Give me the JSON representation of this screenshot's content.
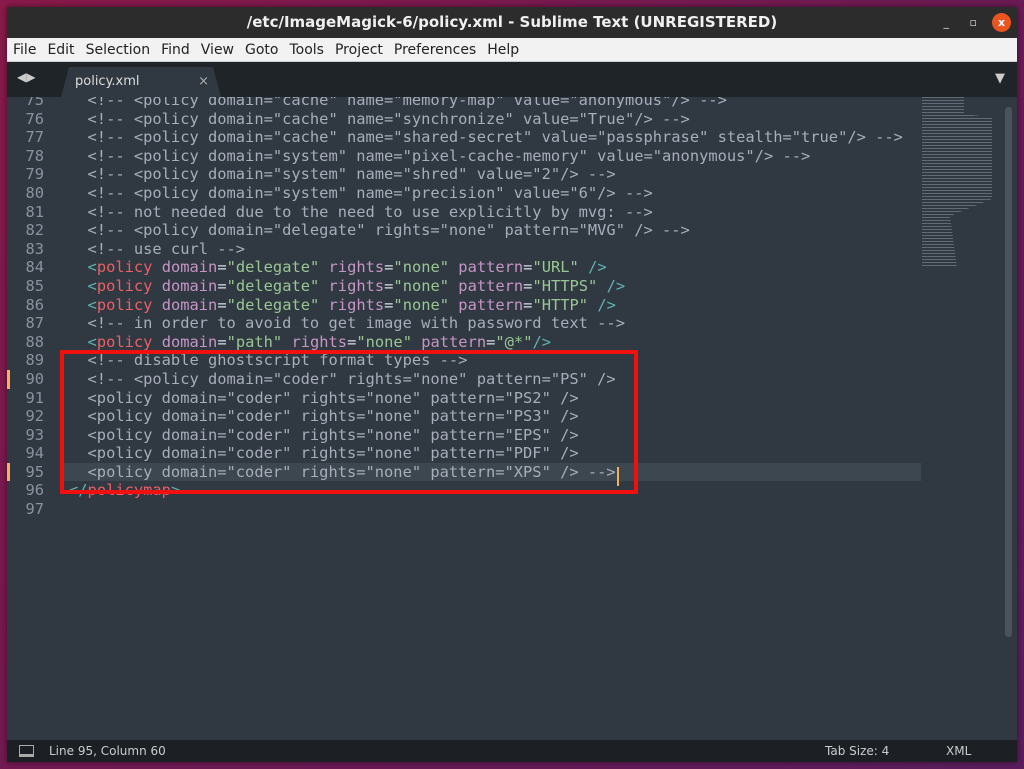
{
  "window": {
    "title": "/etc/ImageMagick-6/policy.xml - Sublime Text (UNREGISTERED)",
    "minimize": "_",
    "maximize": "▫",
    "close": "x"
  },
  "menu": [
    "File",
    "Edit",
    "Selection",
    "Find",
    "View",
    "Goto",
    "Tools",
    "Project",
    "Preferences",
    "Help"
  ],
  "tab": {
    "label": "policy.xml",
    "close": "×"
  },
  "status": {
    "position": "Line 95, Column 60",
    "tab_size": "Tab Size: 4",
    "syntax": "XML"
  },
  "colors": {
    "highlight_box": "#f01010",
    "modified_marker": "#f9ae58",
    "background": "#303841"
  },
  "current_line": 95,
  "modified_lines": [
    90,
    95
  ],
  "lines": [
    {
      "n": "75",
      "seg": [
        [
          "c",
          "  <!-- <policy domain=\"cache\" name=\"memory-map\" value=\"anonymous\"/> -->"
        ]
      ]
    },
    {
      "n": "76",
      "seg": [
        [
          "c",
          "  <!-- <policy domain=\"cache\" name=\"synchronize\" value=\"True\"/> -->"
        ]
      ]
    },
    {
      "n": "77",
      "seg": [
        [
          "c",
          "  <!-- <policy domain=\"cache\" name=\"shared-secret\" value=\"passphrase\" stealth=\"true\"/> -->"
        ]
      ]
    },
    {
      "n": "78",
      "seg": [
        [
          "c",
          "  <!-- <policy domain=\"system\" name=\"pixel-cache-memory\" value=\"anonymous\"/> -->"
        ]
      ]
    },
    {
      "n": "79",
      "seg": [
        [
          "c",
          "  <!-- <policy domain=\"system\" name=\"shred\" value=\"2\"/> -->"
        ]
      ]
    },
    {
      "n": "80",
      "seg": [
        [
          "c",
          "  <!-- <policy domain=\"system\" name=\"precision\" value=\"6\"/> -->"
        ]
      ]
    },
    {
      "n": "81",
      "seg": [
        [
          "c",
          "  <!-- not needed due to the need to use explicitly by mvg: -->"
        ]
      ]
    },
    {
      "n": "82",
      "seg": [
        [
          "c",
          "  <!-- <policy domain=\"delegate\" rights=\"none\" pattern=\"MVG\" /> -->"
        ]
      ]
    },
    {
      "n": "83",
      "seg": [
        [
          "c",
          "  <!-- use curl -->"
        ]
      ]
    },
    {
      "n": "84",
      "seg": [
        [
          "x",
          "  "
        ],
        [
          "p",
          "<"
        ],
        [
          "t",
          "policy"
        ],
        [
          "a",
          " domain"
        ],
        [
          "x",
          "="
        ],
        [
          "s",
          "\"delegate\""
        ],
        [
          "a",
          " rights"
        ],
        [
          "x",
          "="
        ],
        [
          "s",
          "\"none\""
        ],
        [
          "a",
          " pattern"
        ],
        [
          "x",
          "="
        ],
        [
          "s",
          "\"URL\""
        ],
        [
          "p",
          " />"
        ]
      ]
    },
    {
      "n": "85",
      "seg": [
        [
          "x",
          "  "
        ],
        [
          "p",
          "<"
        ],
        [
          "t",
          "policy"
        ],
        [
          "a",
          " domain"
        ],
        [
          "x",
          "="
        ],
        [
          "s",
          "\"delegate\""
        ],
        [
          "a",
          " rights"
        ],
        [
          "x",
          "="
        ],
        [
          "s",
          "\"none\""
        ],
        [
          "a",
          " pattern"
        ],
        [
          "x",
          "="
        ],
        [
          "s",
          "\"HTTPS\""
        ],
        [
          "p",
          " />"
        ]
      ]
    },
    {
      "n": "86",
      "seg": [
        [
          "x",
          "  "
        ],
        [
          "p",
          "<"
        ],
        [
          "t",
          "policy"
        ],
        [
          "a",
          " domain"
        ],
        [
          "x",
          "="
        ],
        [
          "s",
          "\"delegate\""
        ],
        [
          "a",
          " rights"
        ],
        [
          "x",
          "="
        ],
        [
          "s",
          "\"none\""
        ],
        [
          "a",
          " pattern"
        ],
        [
          "x",
          "="
        ],
        [
          "s",
          "\"HTTP\""
        ],
        [
          "p",
          " />"
        ]
      ]
    },
    {
      "n": "87",
      "seg": [
        [
          "c",
          "  <!-- in order to avoid to get image with password text -->"
        ]
      ]
    },
    {
      "n": "88",
      "seg": [
        [
          "x",
          "  "
        ],
        [
          "p",
          "<"
        ],
        [
          "t",
          "policy"
        ],
        [
          "a",
          " domain"
        ],
        [
          "x",
          "="
        ],
        [
          "s",
          "\"path\""
        ],
        [
          "a",
          " rights"
        ],
        [
          "x",
          "="
        ],
        [
          "s",
          "\"none\""
        ],
        [
          "a",
          " pattern"
        ],
        [
          "x",
          "="
        ],
        [
          "s",
          "\"@*\""
        ],
        [
          "p",
          "/>"
        ]
      ]
    },
    {
      "n": "89",
      "seg": [
        [
          "c",
          "  <!-- disable ghostscript format types -->"
        ]
      ]
    },
    {
      "n": "90",
      "seg": [
        [
          "c",
          "  <!-- <policy domain=\"coder\" rights=\"none\" pattern=\"PS\" />"
        ]
      ]
    },
    {
      "n": "91",
      "seg": [
        [
          "c",
          "  <policy domain=\"coder\" rights=\"none\" pattern=\"PS2\" />"
        ]
      ]
    },
    {
      "n": "92",
      "seg": [
        [
          "c",
          "  <policy domain=\"coder\" rights=\"none\" pattern=\"PS3\" />"
        ]
      ]
    },
    {
      "n": "93",
      "seg": [
        [
          "c",
          "  <policy domain=\"coder\" rights=\"none\" pattern=\"EPS\" />"
        ]
      ]
    },
    {
      "n": "94",
      "seg": [
        [
          "c",
          "  <policy domain=\"coder\" rights=\"none\" pattern=\"PDF\" />"
        ]
      ]
    },
    {
      "n": "95",
      "seg": [
        [
          "c",
          "  <policy domain=\"coder\" rights=\"none\" pattern=\"XPS\" /> -->"
        ]
      ]
    },
    {
      "n": "96",
      "seg": [
        [
          "p",
          "</"
        ],
        [
          "t",
          "policymap"
        ],
        [
          "p",
          ">"
        ]
      ]
    },
    {
      "n": "97",
      "seg": []
    }
  ]
}
